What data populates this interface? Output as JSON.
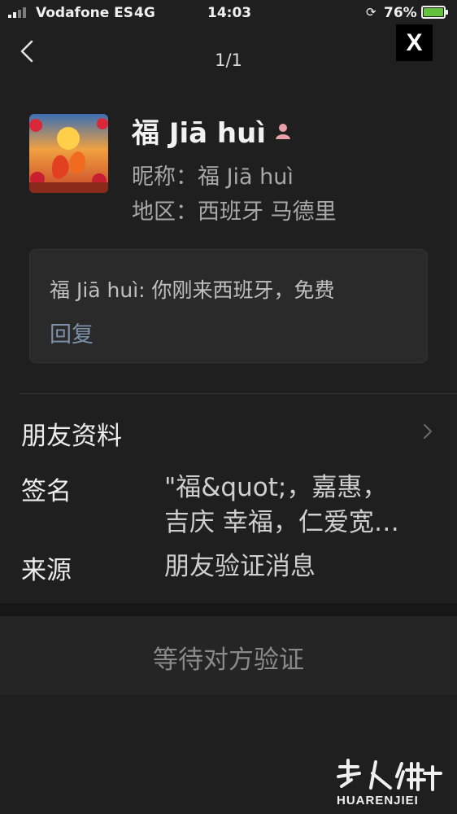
{
  "status_bar": {
    "carrier": "Vodafone ES",
    "network": "4G",
    "time": "14:03",
    "battery_percent": "76%",
    "orientation_lock_icon": "orientation-lock-icon",
    "battery_icon": "battery-charging-icon"
  },
  "nav": {
    "page_indicator": "1/1",
    "close_label": "X",
    "back_icon": "back-chevron-icon"
  },
  "profile": {
    "name": "福  Jiā huì",
    "gender_icon": "female-icon",
    "nickname": "昵称：福  Jiā huì",
    "region": "地区：西班牙 马德里"
  },
  "message": {
    "text": "福  Jiā huì: 你刚来西班牙，免费",
    "reply_label": "回复"
  },
  "friend_info": {
    "title": "朋友资料",
    "signature_label": "签名",
    "signature_line1": "\"福&quot;，嘉惠，",
    "signature_line2": "吉庆 幸福，仁爱宽…",
    "source_label": "来源",
    "source_value": "朋友验证消息"
  },
  "action": {
    "waiting_label": "等待对方验证"
  },
  "watermark": {
    "text": "HUARENJIEI"
  },
  "colors": {
    "background": "#1f1f1f",
    "link": "#7d90aa",
    "battery": "#64c13b",
    "female_badge": "#e8a0a8"
  }
}
